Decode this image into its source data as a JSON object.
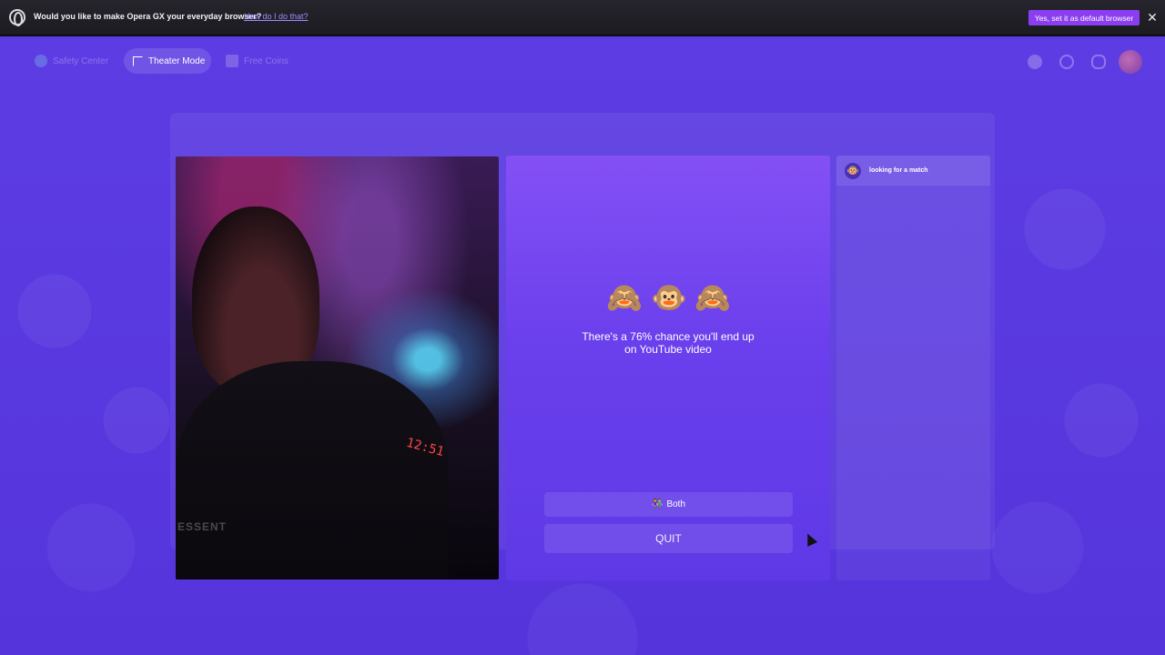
{
  "browser_bar": {
    "prompt": "Would you like to make Opera GX your everyday browser?",
    "link": "How do I do that?",
    "confirm_button": "Yes, set it as default browser",
    "close_icon": "✕"
  },
  "nav": {
    "items": [
      {
        "label": "Safety Center",
        "icon": "shield-icon"
      },
      {
        "label": "Theater Mode",
        "icon": "expand-icon"
      },
      {
        "label": "Free Coins",
        "icon": "coins-icon"
      }
    ]
  },
  "video": {
    "hoodie_text": "ESSENT",
    "clock_text": "12:51"
  },
  "center": {
    "emojis": [
      "🙈",
      "🐵",
      "🙈"
    ],
    "message": "There's a 76% chance you'll end up on YouTube video",
    "both_button": "Both",
    "both_icon": "👫",
    "quit_button": "QUIT"
  },
  "chat": {
    "status": "looking for a match",
    "avatar_emoji": "🐵"
  },
  "colors": {
    "accent": "#8a3ef0",
    "background": "#5a3ae0",
    "panel": "#7a4cf2"
  }
}
